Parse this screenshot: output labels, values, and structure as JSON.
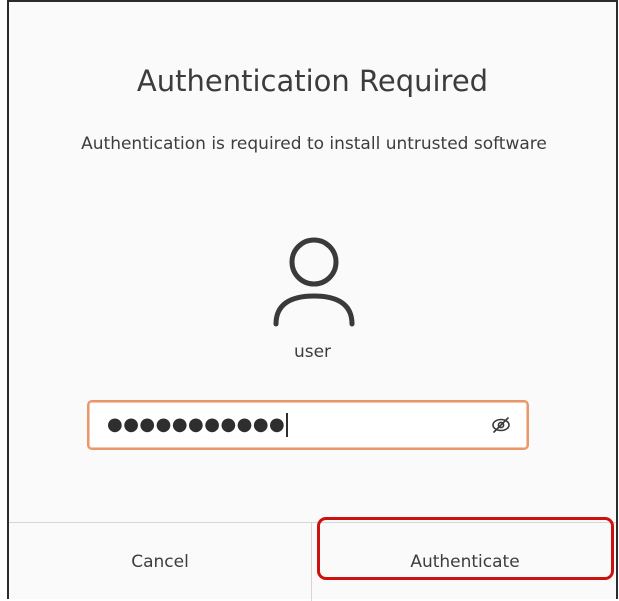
{
  "dialog": {
    "title": "Authentication Required",
    "message": "Authentication is required to install untrusted software",
    "user": {
      "name": "user",
      "avatar_icon": "user-avatar-icon"
    },
    "password": {
      "masked_value": "●●●●●●●●●●●",
      "reveal_icon": "eye-slash-icon"
    },
    "buttons": {
      "cancel_label": "Cancel",
      "authenticate_label": "Authenticate"
    }
  },
  "colors": {
    "focus_border": "#e8966a",
    "highlight": "#cc1111",
    "text": "#3d3d3d"
  }
}
